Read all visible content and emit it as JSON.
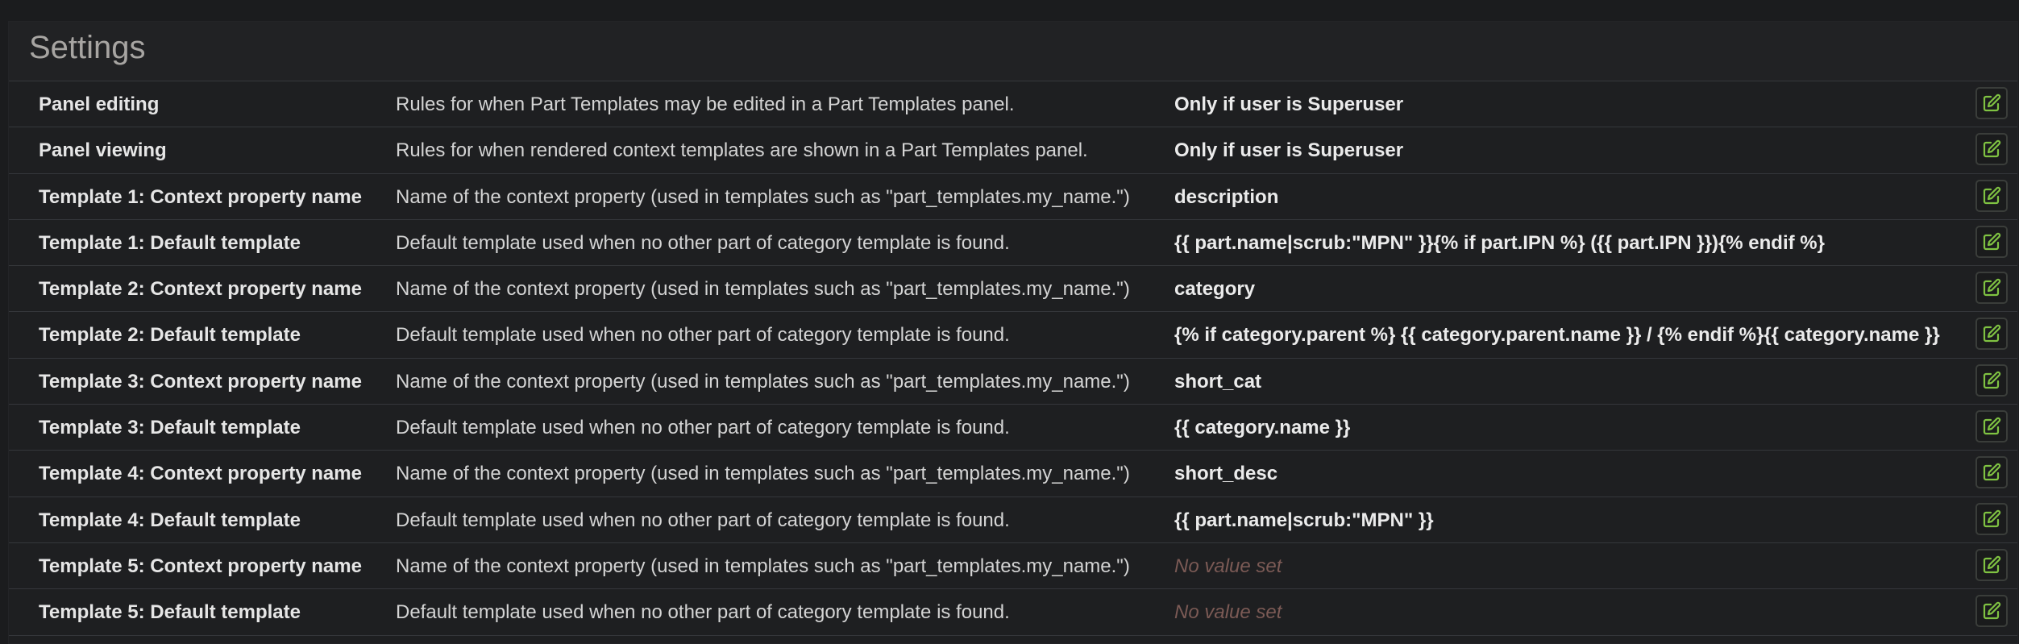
{
  "panel": {
    "title": "Settings"
  },
  "settings": [
    {
      "name": "Panel editing",
      "description": "Rules for when Part Templates may be edited in a Part Templates panel.",
      "value": "Only if user is Superuser"
    },
    {
      "name": "Panel viewing",
      "description": "Rules for when rendered context templates are shown in a Part Templates panel.",
      "value": "Only if user is Superuser"
    },
    {
      "name": "Template 1: Context property name",
      "description": "Name of the context property (used in templates such as \"part_templates.my_name.\")",
      "value": "description"
    },
    {
      "name": "Template 1: Default template",
      "description": "Default template used when no other part of category template is found.",
      "value": "{{ part.name|scrub:\"MPN\" }}{% if part.IPN %} ({{ part.IPN }}){% endif %}"
    },
    {
      "name": "Template 2: Context property name",
      "description": "Name of the context property (used in templates such as \"part_templates.my_name.\")",
      "value": "category"
    },
    {
      "name": "Template 2: Default template",
      "description": "Default template used when no other part of category template is found.",
      "value": "{% if category.parent %} {{ category.parent.name }} / {% endif %}{{ category.name }}"
    },
    {
      "name": "Template 3: Context property name",
      "description": "Name of the context property (used in templates such as \"part_templates.my_name.\")",
      "value": "short_cat"
    },
    {
      "name": "Template 3: Default template",
      "description": "Default template used when no other part of category template is found.",
      "value": "{{ category.name }}"
    },
    {
      "name": "Template 4: Context property name",
      "description": "Name of the context property (used in templates such as \"part_templates.my_name.\")",
      "value": "short_desc"
    },
    {
      "name": "Template 4: Default template",
      "description": "Default template used when no other part of category template is found.",
      "value": "{{ part.name|scrub:\"MPN\" }}"
    },
    {
      "name": "Template 5: Context property name",
      "description": "Name of the context property (used in templates such as \"part_templates.my_name.\")",
      "value": "No value set"
    },
    {
      "name": "Template 5: Default template",
      "description": "Default template used when no other part of category template is found.",
      "value": "No value set"
    }
  ],
  "empty_value_text": "No value set",
  "icons": {
    "edit": "edit-icon"
  },
  "colors": {
    "accent_icon": "#7fc242",
    "empty_value": "#7b5a55",
    "title": "#a7a5a2"
  }
}
